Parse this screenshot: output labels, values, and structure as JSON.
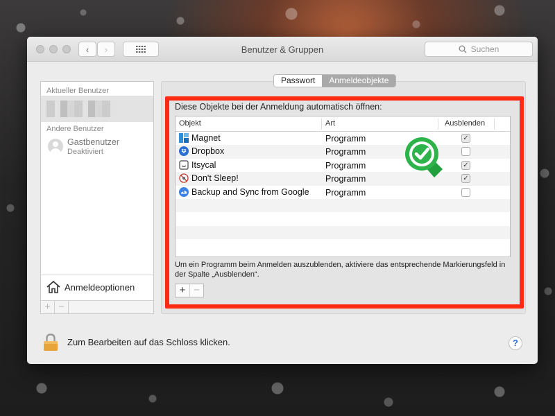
{
  "window": {
    "title": "Benutzer & Gruppen"
  },
  "toolbar": {
    "back_glyph": "‹",
    "forward_glyph": "›",
    "search_placeholder": "Suchen"
  },
  "sidebar": {
    "current_user_heading": "Aktueller Benutzer",
    "other_users_heading": "Andere Benutzer",
    "guest_name": "Gastbenutzer",
    "guest_status": "Deaktiviert",
    "login_options_label": "Anmeldeoptionen",
    "add_glyph": "+",
    "remove_glyph": "−"
  },
  "tabs": [
    {
      "label": "Passwort",
      "selected": false
    },
    {
      "label": "Anmeldeobjekte",
      "selected": true
    }
  ],
  "login_items": {
    "title": "Diese Objekte bei der Anmeldung automatisch öffnen:",
    "columns": [
      "Objekt",
      "Art",
      "Ausblenden"
    ],
    "rows": [
      {
        "name": "Magnet",
        "type": "Programm",
        "hide": true,
        "icon": "magnet-icon"
      },
      {
        "name": "Dropbox",
        "type": "Programm",
        "hide": false,
        "icon": "dropbox-icon"
      },
      {
        "name": "Itsycal",
        "type": "Programm",
        "hide": true,
        "icon": "itsycal-icon"
      },
      {
        "name": "Don't Sleep!",
        "type": "Programm",
        "hide": true,
        "icon": "dont-sleep-icon"
      },
      {
        "name": "Backup and Sync from Google",
        "type": "Programm",
        "hide": false,
        "icon": "google-backup-icon"
      }
    ],
    "hint": "Um ein Programm beim Anmelden auszublenden, aktiviere das entsprechende Markierungsfeld in der Spalte „Ausblenden“.",
    "add_glyph": "+",
    "remove_glyph": "−"
  },
  "footer": {
    "lock_text": "Zum Bearbeiten auf das Schloss klicken.",
    "help_glyph": "?"
  },
  "colors": {
    "highlight": "#ff2a14",
    "badge": "#2db34a",
    "check_mark": "✓"
  }
}
